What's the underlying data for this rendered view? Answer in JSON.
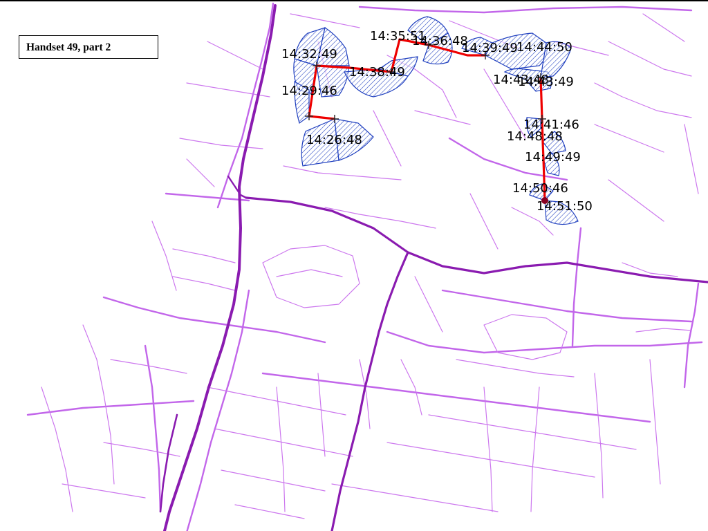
{
  "caption": "Handset 49, part 2",
  "colors": {
    "background": "#ffffff",
    "street": "#cc77ee",
    "highway": "#8a1bb0",
    "sector_outline": "#1f3fbf",
    "track": "#ee0000",
    "label": "#000000"
  },
  "timestamps": [
    "14:32:49",
    "14:29:46",
    "14:26:48",
    "14:38:49",
    "14:35:51",
    "14:36:48",
    "14:39:49",
    "14:44:50",
    "14:43:48",
    "14:43:49",
    "14:41:46",
    "14:48:48",
    "14:49:49",
    "14:50:46",
    "14:51:50"
  ]
}
